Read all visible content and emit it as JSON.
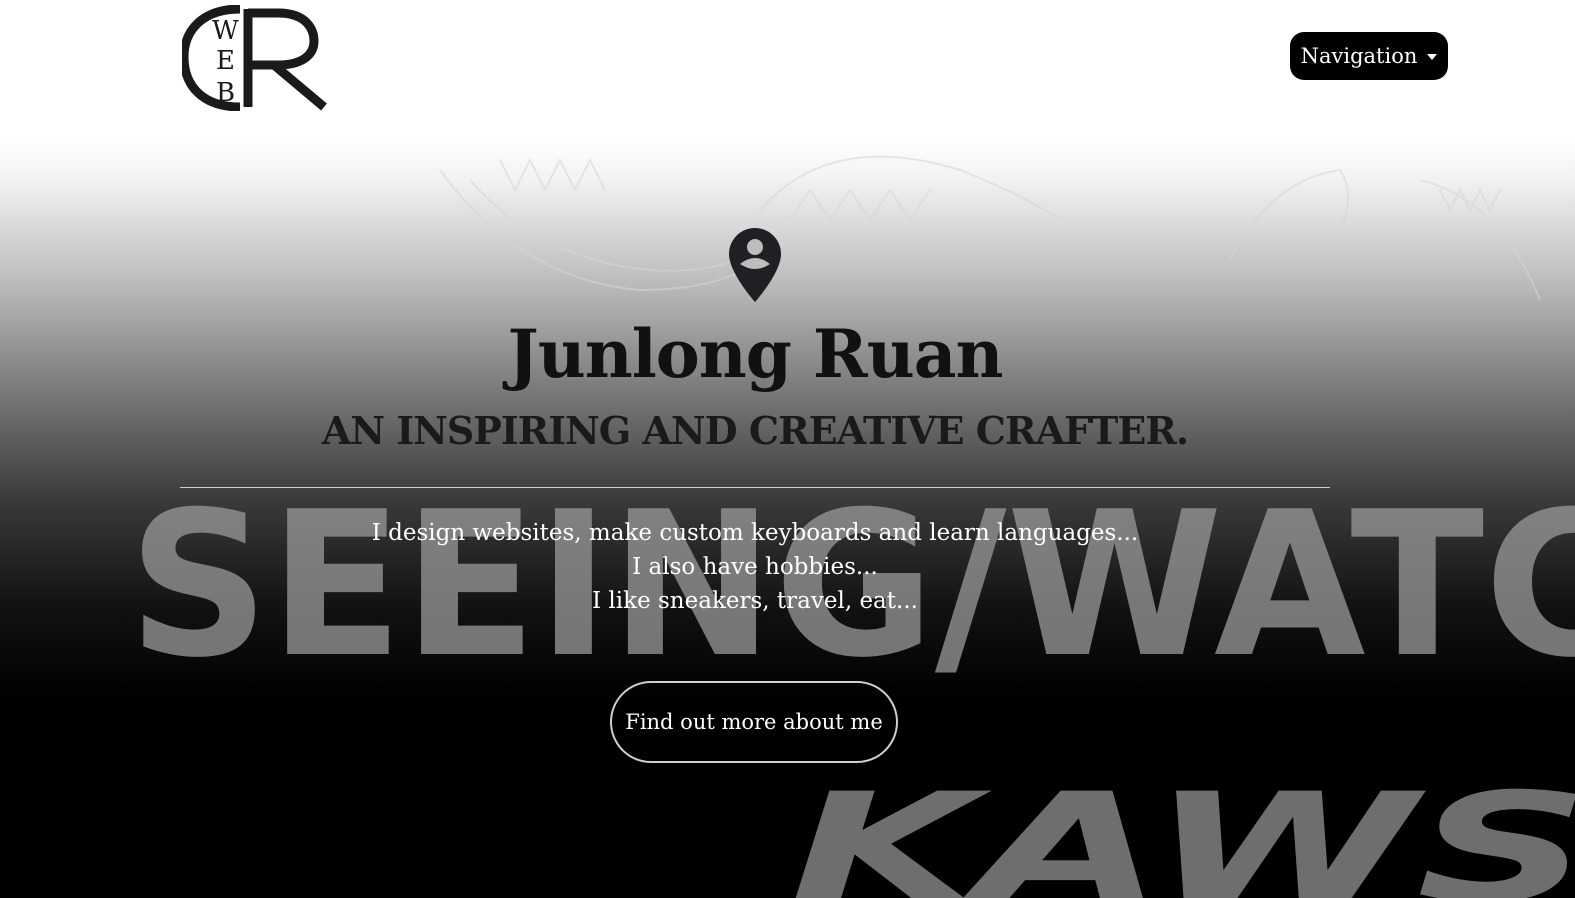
{
  "header": {
    "logo": {
      "icon": "wr-logo",
      "vertical_letters": "WEB",
      "big_letter": "R"
    },
    "navigation_label": "Navigation"
  },
  "hero": {
    "icon": "user-location-pin-icon",
    "name": "Junlong Ruan",
    "tagline": "AN INSPIRING AND CREATIVE CRAFTER.",
    "description_lines": [
      "I design websites, make custom keyboards and learn languages...",
      "I also have hobbies...",
      "I like sneakers, travel, eat..."
    ],
    "cta_label": "Find out more about me",
    "background": {
      "image_text": "SEEING/WATC",
      "image_text_2": "KAWS"
    }
  },
  "colors": {
    "button_bg": "#000000",
    "text_dark": "#111111",
    "text_light": "#ffffff"
  }
}
